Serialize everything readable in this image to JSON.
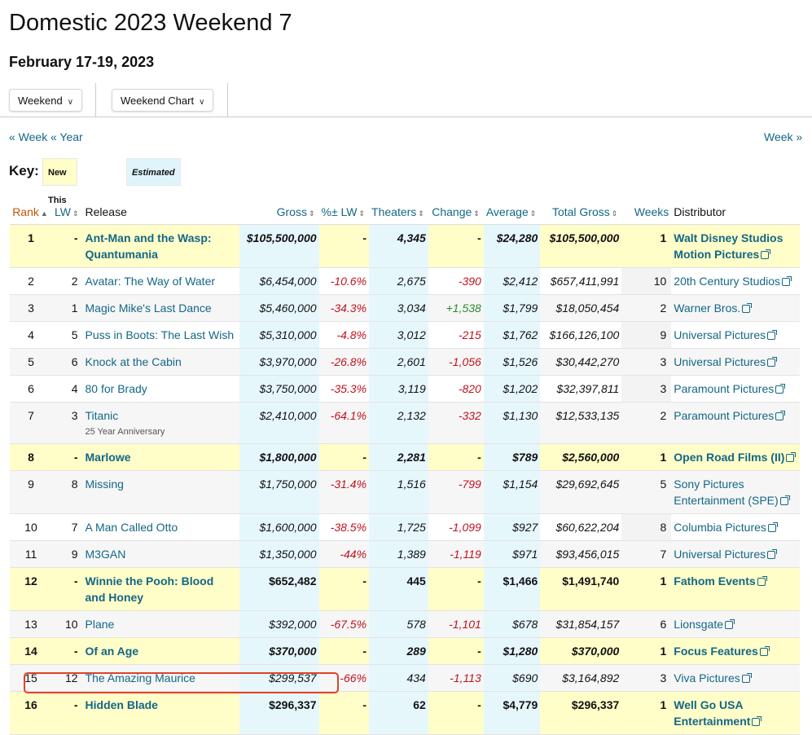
{
  "page": {
    "title": "Domestic 2023 Weekend 7",
    "subtitle": "February 17-19, 2023"
  },
  "toolbar": {
    "dropdown1": "Weekend",
    "dropdown2": "Weekend Chart"
  },
  "nav": {
    "prev_week": "« Week",
    "prev_year": "« Year",
    "next_week": "Week »"
  },
  "key": {
    "label": "Key:",
    "new_this_week": "New This Week",
    "estimated": "Estimated"
  },
  "table": {
    "headers": {
      "rank": "Rank",
      "lw": "LW",
      "release": "Release",
      "gross": "Gross",
      "pct_lw": "%± LW",
      "theaters": "Theaters",
      "change": "Change",
      "average": "Average",
      "total_gross": "Total Gross",
      "weeks": "Weeks",
      "distributor": "Distributor"
    },
    "rows": [
      {
        "rank": "1",
        "lw": "-",
        "release": "Ant-Man and the Wasp: Quantumania",
        "sub": "",
        "gross": "$105,500,000",
        "pct": "-",
        "theaters": "4,345",
        "change": "-",
        "average": "$24,280",
        "total": "$105,500,000",
        "weeks": "1",
        "distributor": "Walt Disney Studios Motion Pictures"
      },
      {
        "rank": "2",
        "lw": "2",
        "release": "Avatar: The Way of Water",
        "sub": "",
        "gross": "$6,454,000",
        "pct": "-10.6%",
        "theaters": "2,675",
        "change": "-390",
        "average": "$2,412",
        "total": "$657,411,991",
        "weeks": "10",
        "distributor": "20th Century Studios"
      },
      {
        "rank": "3",
        "lw": "1",
        "release": "Magic Mike's Last Dance",
        "sub": "",
        "gross": "$5,460,000",
        "pct": "-34.3%",
        "theaters": "3,034",
        "change": "+1,538",
        "average": "$1,799",
        "total": "$18,050,454",
        "weeks": "2",
        "distributor": "Warner Bros."
      },
      {
        "rank": "4",
        "lw": "5",
        "release": "Puss in Boots: The Last Wish",
        "sub": "",
        "gross": "$5,310,000",
        "pct": "-4.8%",
        "theaters": "3,012",
        "change": "-215",
        "average": "$1,762",
        "total": "$166,126,100",
        "weeks": "9",
        "distributor": "Universal Pictures"
      },
      {
        "rank": "5",
        "lw": "6",
        "release": "Knock at the Cabin",
        "sub": "",
        "gross": "$3,970,000",
        "pct": "-26.8%",
        "theaters": "2,601",
        "change": "-1,056",
        "average": "$1,526",
        "total": "$30,442,270",
        "weeks": "3",
        "distributor": "Universal Pictures"
      },
      {
        "rank": "6",
        "lw": "4",
        "release": "80 for Brady",
        "sub": "",
        "gross": "$3,750,000",
        "pct": "-35.3%",
        "theaters": "3,119",
        "change": "-820",
        "average": "$1,202",
        "total": "$32,397,811",
        "weeks": "3",
        "distributor": "Paramount Pictures"
      },
      {
        "rank": "7",
        "lw": "3",
        "release": "Titanic",
        "sub": "25 Year Anniversary",
        "gross": "$2,410,000",
        "pct": "-64.1%",
        "theaters": "2,132",
        "change": "-332",
        "average": "$1,130",
        "total": "$12,533,135",
        "weeks": "2",
        "distributor": "Paramount Pictures"
      },
      {
        "rank": "8",
        "lw": "-",
        "release": "Marlowe",
        "sub": "",
        "gross": "$1,800,000",
        "pct": "-",
        "theaters": "2,281",
        "change": "-",
        "average": "$789",
        "total": "$2,560,000",
        "weeks": "1",
        "distributor": "Open Road Films (II)"
      },
      {
        "rank": "9",
        "lw": "8",
        "release": "Missing",
        "sub": "",
        "gross": "$1,750,000",
        "pct": "-31.4%",
        "theaters": "1,516",
        "change": "-799",
        "average": "$1,154",
        "total": "$29,692,645",
        "weeks": "5",
        "distributor": "Sony Pictures Entertainment (SPE)"
      },
      {
        "rank": "10",
        "lw": "7",
        "release": "A Man Called Otto",
        "sub": "",
        "gross": "$1,600,000",
        "pct": "-38.5%",
        "theaters": "1,725",
        "change": "-1,099",
        "average": "$927",
        "total": "$60,622,204",
        "weeks": "8",
        "distributor": "Columbia Pictures"
      },
      {
        "rank": "11",
        "lw": "9",
        "release": "M3GAN",
        "sub": "",
        "gross": "$1,350,000",
        "pct": "-44%",
        "theaters": "1,389",
        "change": "-1,119",
        "average": "$971",
        "total": "$93,456,015",
        "weeks": "7",
        "distributor": "Universal Pictures"
      },
      {
        "rank": "12",
        "lw": "-",
        "release": "Winnie the Pooh: Blood and Honey",
        "sub": "",
        "gross": "$652,482",
        "pct": "-",
        "theaters": "445",
        "change": "-",
        "average": "$1,466",
        "total": "$1,491,740",
        "weeks": "1",
        "distributor": "Fathom Events"
      },
      {
        "rank": "13",
        "lw": "10",
        "release": "Plane",
        "sub": "",
        "gross": "$392,000",
        "pct": "-67.5%",
        "theaters": "578",
        "change": "-1,101",
        "average": "$678",
        "total": "$31,854,157",
        "weeks": "6",
        "distributor": "Lionsgate"
      },
      {
        "rank": "14",
        "lw": "-",
        "release": "Of an Age",
        "sub": "",
        "gross": "$370,000",
        "pct": "-",
        "theaters": "289",
        "change": "-",
        "average": "$1,280",
        "total": "$370,000",
        "weeks": "1",
        "distributor": "Focus Features"
      },
      {
        "rank": "15",
        "lw": "12",
        "release": "The Amazing Maurice",
        "sub": "",
        "gross": "$299,537",
        "pct": "-66%",
        "theaters": "434",
        "change": "-1,113",
        "average": "$690",
        "total": "$3,164,892",
        "weeks": "3",
        "distributor": "Viva Pictures"
      },
      {
        "rank": "16",
        "lw": "-",
        "release": "Hidden Blade",
        "sub": "",
        "gross": "$296,337",
        "pct": "-",
        "theaters": "62",
        "change": "-",
        "average": "$4,779",
        "total": "$296,337",
        "weeks": "1",
        "distributor": "Well Go USA Entertainment"
      }
    ]
  },
  "colors": {
    "link": "#136785",
    "rank_header": "#c45500",
    "new_row": "#fffdc8",
    "estimated": "#e6f7fc",
    "negative": "#c1121f",
    "positive": "#2e8b2e",
    "highlight_box": "#e0412a"
  }
}
